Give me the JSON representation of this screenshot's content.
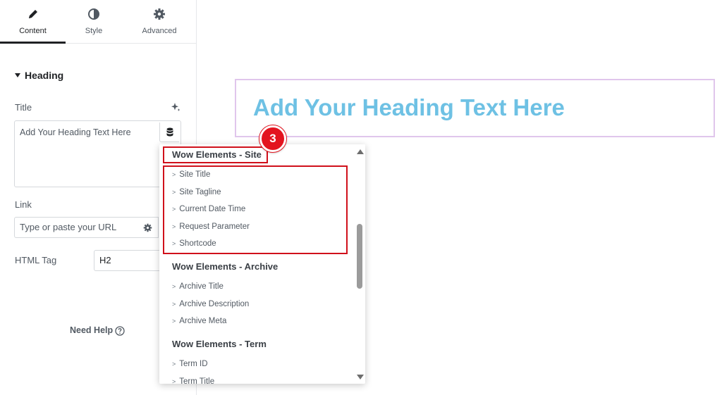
{
  "tabs": [
    {
      "label": "Content",
      "icon": "pencil-icon",
      "active": true
    },
    {
      "label": "Style",
      "icon": "contrast-icon",
      "active": false
    },
    {
      "label": "Advanced",
      "icon": "gear-icon",
      "active": false
    }
  ],
  "section": {
    "title": "Heading"
  },
  "fields": {
    "title_label": "Title",
    "title_value": "Add Your Heading Text Here",
    "link_label": "Link",
    "link_placeholder": "Type or paste your URL",
    "html_tag_label": "HTML Tag",
    "html_tag_value": "H2"
  },
  "help": {
    "label": "Need Help"
  },
  "preview": {
    "heading": "Add Your Heading Text Here"
  },
  "dropdown": {
    "groups": [
      {
        "title": "Wow Elements - Site",
        "items": [
          "Site Title",
          "Site Tagline",
          "Current Date Time",
          "Request Parameter",
          "Shortcode"
        ]
      },
      {
        "title": "Wow Elements - Archive",
        "items": [
          "Archive Title",
          "Archive Description",
          "Archive Meta"
        ]
      },
      {
        "title": "Wow Elements - Term",
        "items": [
          "Term ID",
          "Term Title"
        ]
      }
    ]
  },
  "annotation": {
    "step": "3",
    "color": "#d0101b"
  },
  "colors": {
    "heading": "#6ec1e4",
    "selection_border": "#e0c6ec"
  }
}
